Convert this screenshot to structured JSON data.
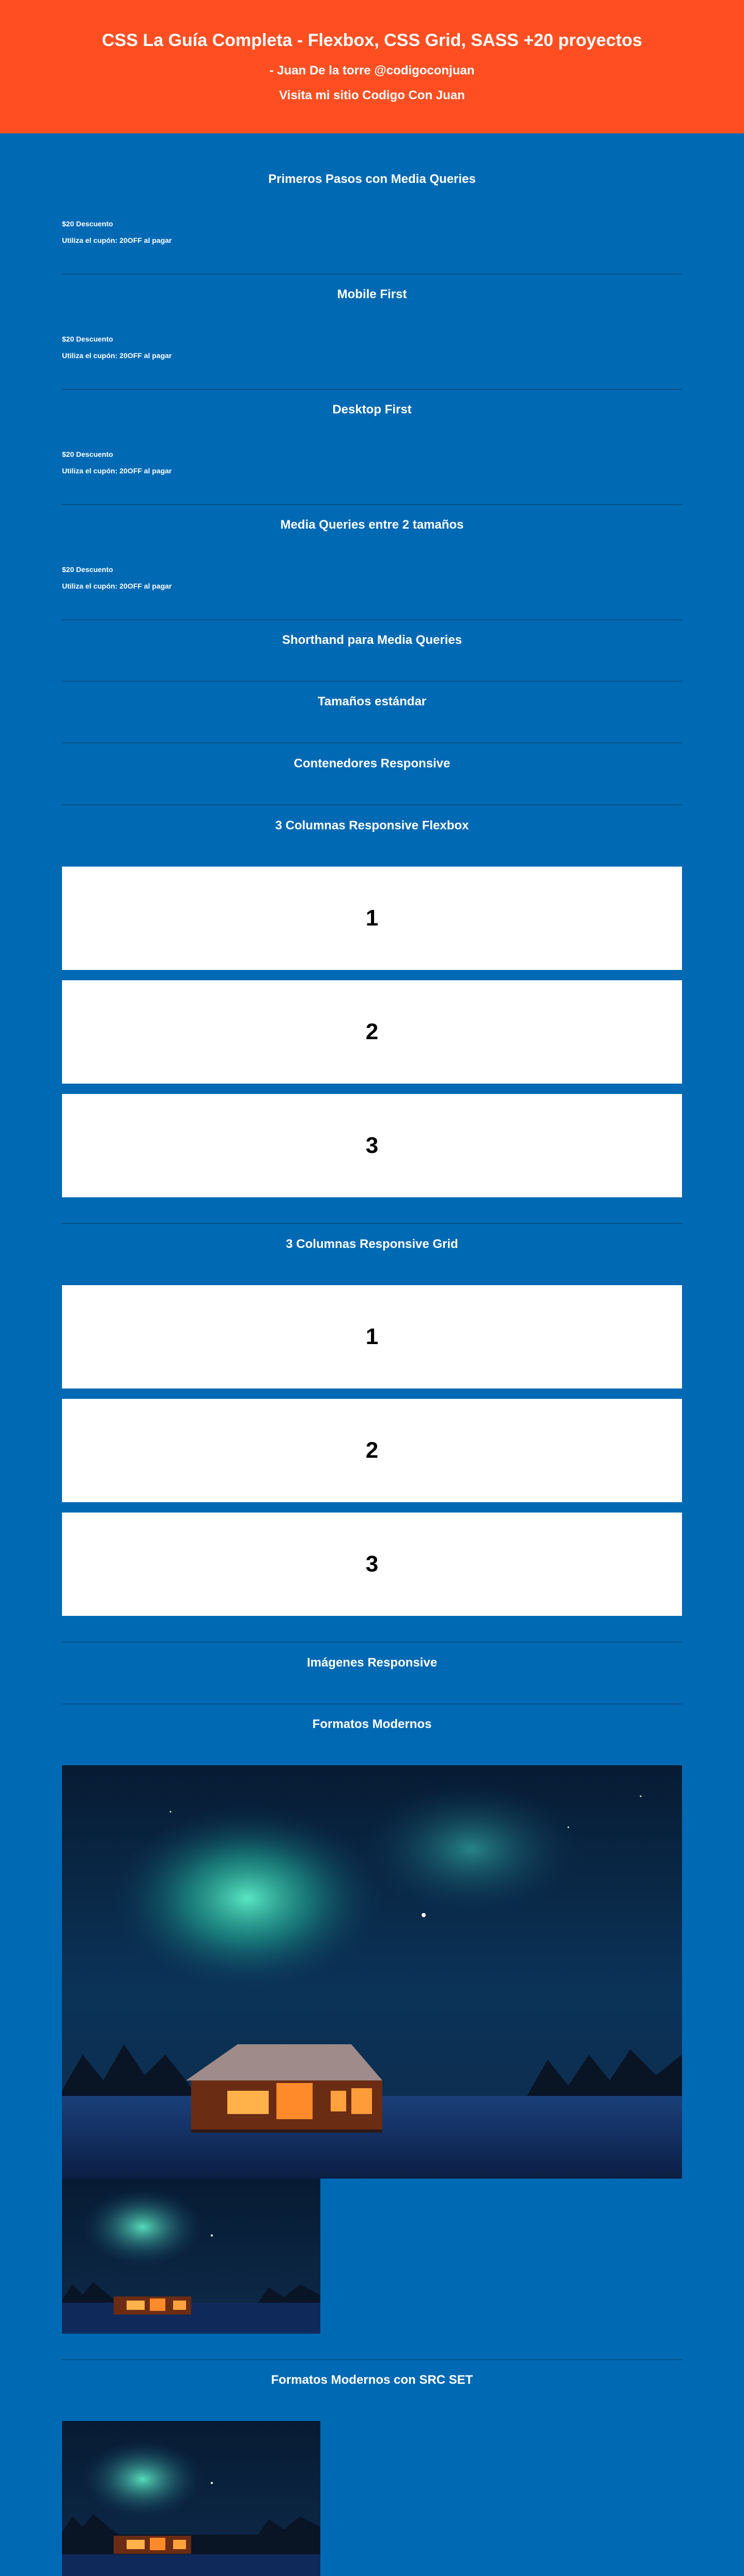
{
  "header": {
    "title": "CSS La Guía Completa - Flexbox, CSS Grid, SASS +20 proyectos",
    "author": "- Juan De la torre @codigoconjuan",
    "site_link": "Visita mi sitio Codigo Con Juan"
  },
  "sections": {
    "s1": {
      "title": "Primeros Pasos con Media Queries",
      "promo_title": "$20 Descuento",
      "promo_text": "Utiliza el cupón: 20OFF al pagar"
    },
    "s2": {
      "title": "Mobile First",
      "promo_title": "$20 Descuento",
      "promo_text": "Utiliza el cupón: 20OFF al pagar"
    },
    "s3": {
      "title": "Desktop First",
      "promo_title": "$20 Descuento",
      "promo_text": "Utiliza el cupón: 20OFF al pagar"
    },
    "s4": {
      "title": "Media Queries entre 2 tamaños",
      "promo_title": "$20 Descuento",
      "promo_text": "Utiliza el cupón: 20OFF al pagar"
    },
    "s5": {
      "title": "Shorthand para Media Queries"
    },
    "s6": {
      "title": "Tamaños estándar"
    },
    "s7": {
      "title": "Contenedores Responsive"
    },
    "s8": {
      "title": "3 Columnas Responsive Flexbox",
      "cards": [
        "1",
        "2",
        "3"
      ]
    },
    "s9": {
      "title": "3 Columnas Responsive Grid",
      "cards": [
        "1",
        "2",
        "3"
      ]
    },
    "s10": {
      "title": "Imágenes Responsive"
    },
    "s11": {
      "title": "Formatos Modernos"
    },
    "s12": {
      "title": "Formatos Modernos con SRC SET"
    }
  },
  "images": {
    "aurora": "aurora-cabin-photo"
  },
  "colors": {
    "header_bg": "#ff4f22",
    "page_bg": "#0069b4",
    "card_bg": "#ffffff",
    "divider": "#0a3a5c"
  }
}
